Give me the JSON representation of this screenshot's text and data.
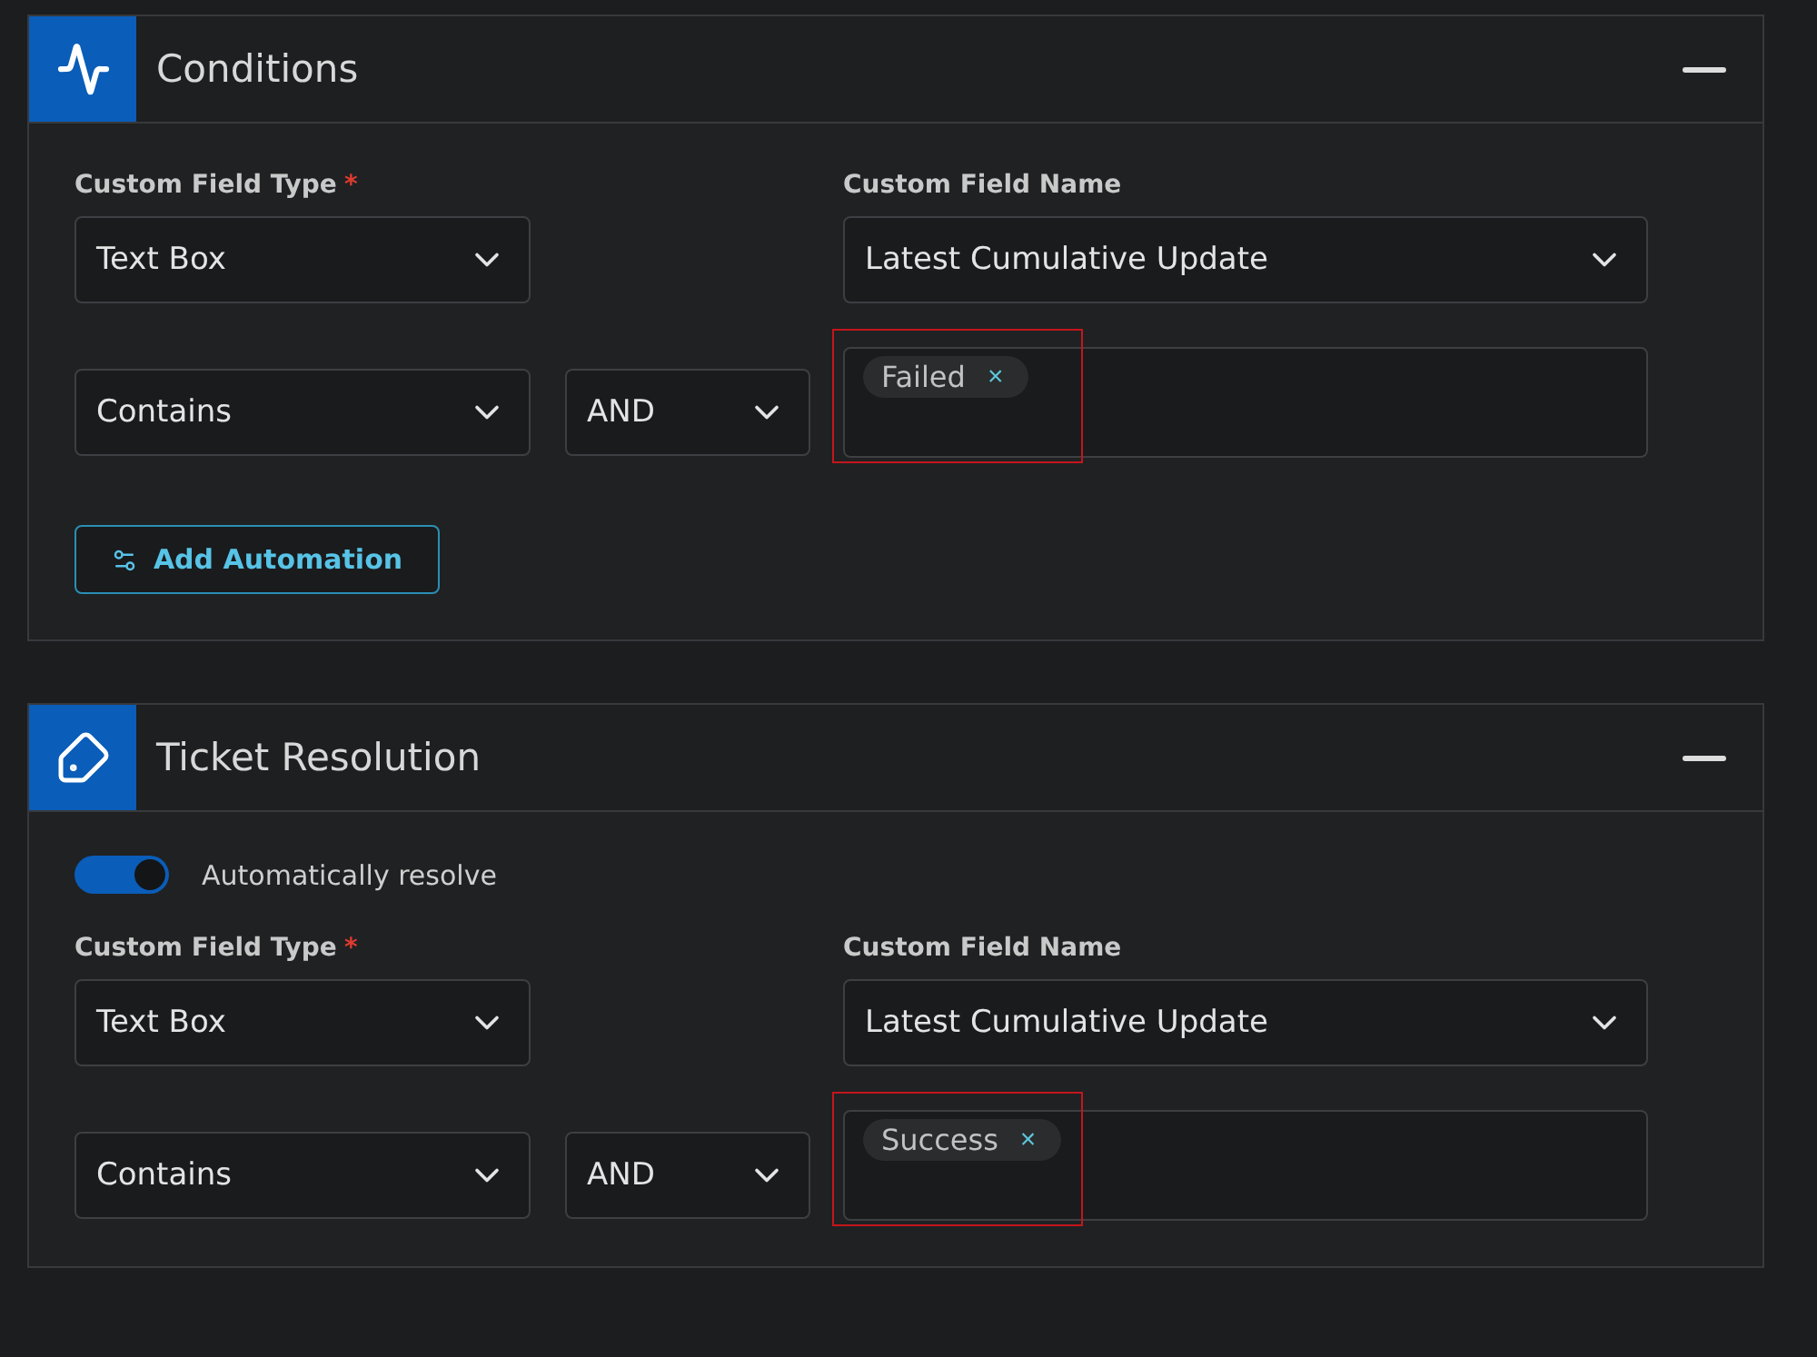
{
  "sections": [
    {
      "kind": "conditions",
      "title": "Conditions",
      "collapse_expanded": true,
      "field_type": {
        "label": "Custom Field Type",
        "required": true,
        "required_mark": "*",
        "value": "Text Box"
      },
      "field_name": {
        "label": "Custom Field Name",
        "value": "Latest Cumulative Update"
      },
      "operator": "Contains",
      "conjunction": "AND",
      "tags": [
        {
          "text": "Failed",
          "remove": "×"
        }
      ],
      "highlighted": true,
      "button": "Add Automation"
    },
    {
      "kind": "resolution",
      "title": "Ticket Resolution",
      "collapse_expanded": true,
      "toggle": {
        "label": "Automatically resolve",
        "on": true
      },
      "field_type": {
        "label": "Custom Field Type",
        "required": true,
        "required_mark": "*",
        "value": "Text Box"
      },
      "field_name": {
        "label": "Custom Field Name",
        "value": "Latest Cumulative Update"
      },
      "operator": "Contains",
      "conjunction": "AND",
      "tags": [
        {
          "text": "Success",
          "remove": "×"
        }
      ],
      "highlighted": true
    }
  ]
}
